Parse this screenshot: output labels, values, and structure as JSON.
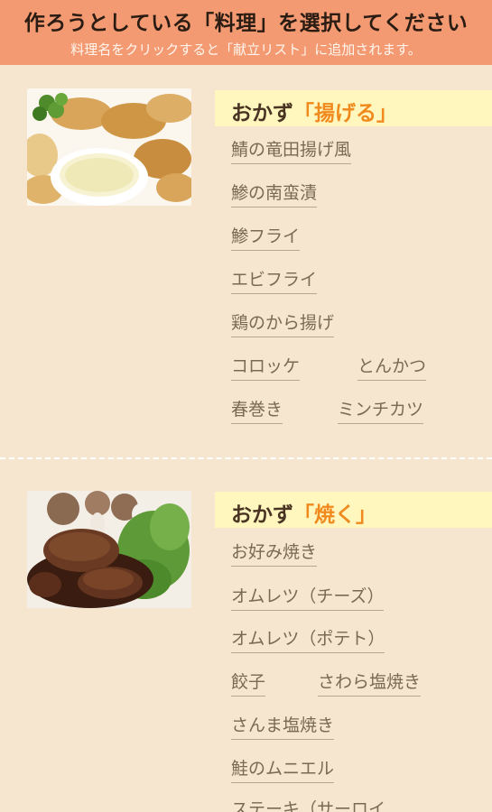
{
  "header": {
    "title": "作ろうとしている「料理」を選択してください",
    "subtitle": "料理名をクリックすると「献立リスト」に追加されます。"
  },
  "sections": [
    {
      "heading_prefix": "おかず",
      "heading_accent": "「揚げる」",
      "items": [
        "鯖の竜田揚げ風",
        "鯵の南蛮漬",
        "鯵フライ",
        "エビフライ",
        "鶏のから揚げ",
        "コロッケ",
        "とんかつ",
        "春巻き",
        "ミンチカツ"
      ]
    },
    {
      "heading_prefix": "おかず",
      "heading_accent": "「焼く」",
      "items": [
        "お好み焼き",
        "オムレツ（チーズ）",
        "オムレツ（ポテト）",
        "餃子",
        "さわら塩焼き",
        "さんま塩焼き",
        "鮭のムニエル",
        "ステーキ（サーロイ"
      ]
    }
  ],
  "colors": {
    "header_bg": "#f39a72",
    "page_bg": "#f6e6cf",
    "heading_bg": "#fff7bd",
    "accent": "#f08a1e"
  }
}
